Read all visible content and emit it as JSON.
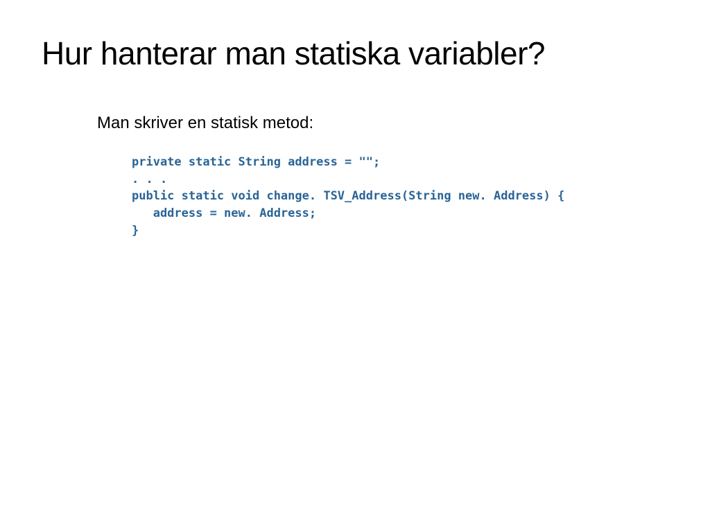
{
  "slide": {
    "title": "Hur hanterar man statiska variabler?",
    "subtitle": "Man skriver en statisk metod:",
    "code": "private static String address = \"\";\n. . .\npublic static void change. TSV_Address(String new. Address) {\n   address = new. Address;\n}"
  }
}
